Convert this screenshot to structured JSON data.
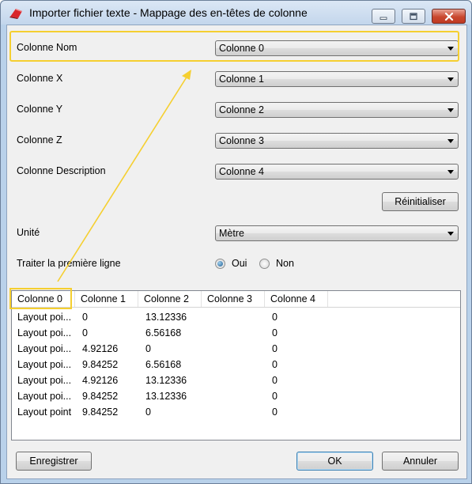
{
  "window": {
    "title": "Importer fichier texte - Mappage des en-têtes de colonne",
    "colors": {
      "highlight": "#f5cf30",
      "radio_selected": "#1d5b8f",
      "close_button": "#c9482f"
    }
  },
  "mapping": {
    "rows": [
      {
        "label": "Colonne Nom",
        "value": "Colonne 0"
      },
      {
        "label": "Colonne X",
        "value": "Colonne 1"
      },
      {
        "label": "Colonne Y",
        "value": "Colonne 2"
      },
      {
        "label": "Colonne Z",
        "value": "Colonne 3"
      },
      {
        "label": "Colonne Description",
        "value": "Colonne 4"
      }
    ],
    "reset_label": "Réinitialiser",
    "unit_label": "Unité",
    "unit_value": "Mètre",
    "first_line_label": "Traiter la première ligne",
    "first_line_yes": "Oui",
    "first_line_no": "Non",
    "first_line_selected": "Oui"
  },
  "preview": {
    "headers": [
      "Colonne 0",
      "Colonne 1",
      "Colonne 2",
      "Colonne 3",
      "Colonne 4"
    ],
    "rows": [
      [
        "Layout poi...",
        "0",
        "13.12336",
        "",
        "0"
      ],
      [
        "Layout poi...",
        "0",
        "6.56168",
        "",
        "0"
      ],
      [
        "Layout poi...",
        "4.92126",
        "0",
        "",
        "0"
      ],
      [
        "Layout poi...",
        "9.84252",
        "6.56168",
        "",
        "0"
      ],
      [
        "Layout poi...",
        "4.92126",
        "13.12336",
        "",
        "0"
      ],
      [
        "Layout poi...",
        "9.84252",
        "13.12336",
        "",
        "0"
      ],
      [
        "Layout point",
        "9.84252",
        "0",
        "",
        "0"
      ]
    ]
  },
  "footer": {
    "save_label": "Enregistrer",
    "ok_label": "OK",
    "cancel_label": "Annuler"
  }
}
